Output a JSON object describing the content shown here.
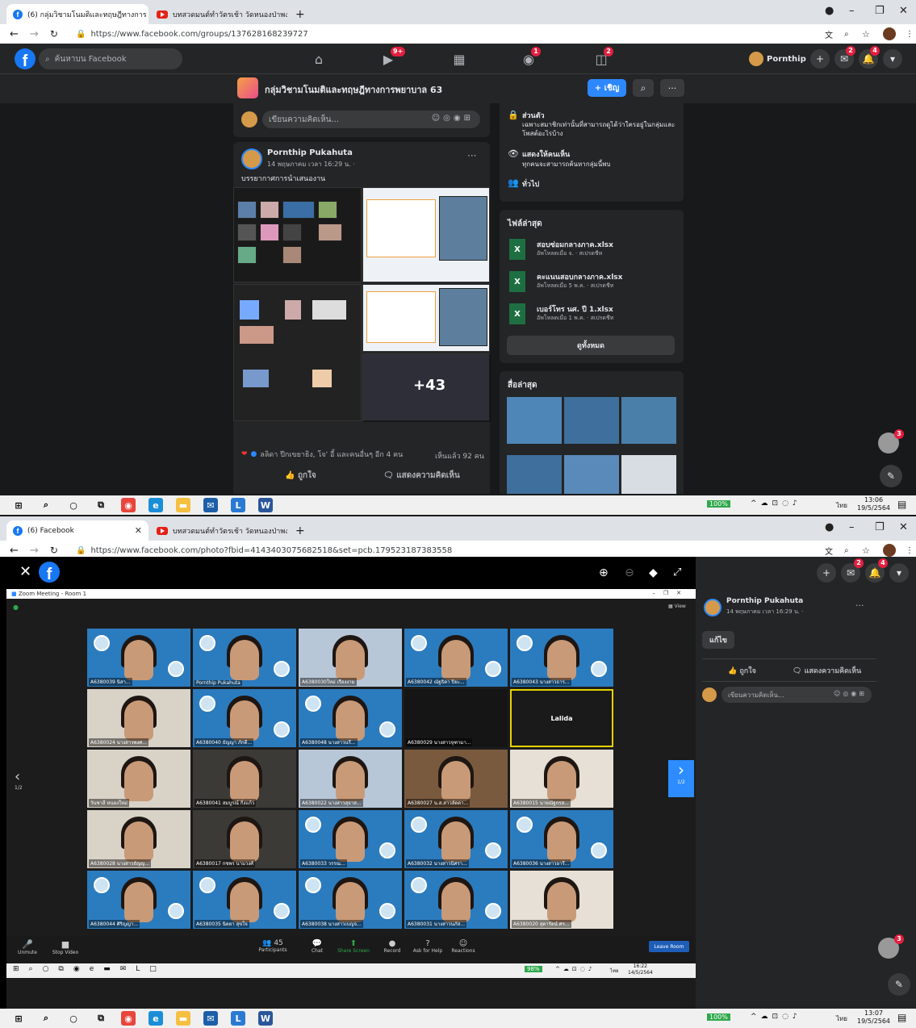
{
  "top": {
    "tabs": [
      {
        "title": "(6) กลุ่มวิชามโนมติและทฤษฎีทางการ"
      },
      {
        "title": "บทสวดมนต์ทำวัตรเช้า วัดหนองป่าพง"
      }
    ],
    "url": "https://www.facebook.com/groups/137628168239727",
    "search_placeholder": "ค้นหาบน Facebook",
    "badges": {
      "watch": "9+",
      "groups": "1",
      "gaming": "2",
      "messenger": "2",
      "notifications": "4"
    },
    "profile_name": "Pornthip",
    "group_name": "กลุ่มวิชามโนมติและทฤษฎีทางการพยาบาล 63",
    "invite_label": "+ เชิญ",
    "comment_placeholder": "เขียนความคิดเห็น...",
    "post": {
      "author": "Pornthip Pukahuta",
      "date": "14 พฤษภาคม เวลา 16:29 น. ·",
      "text": "บรรยากาศการนำเสนองาน",
      "more_count": "+43",
      "reactions_text": "ลลิดา ปีกเขยาธิง, โจ' อี้ และคนอื่นๆ อีก 4 คน",
      "seen_text": "เห็นแล้ว 92 คน",
      "like_label": "ถูกใจ",
      "comment_label": "แสดงความคิดเห็น"
    },
    "about": {
      "private_title": "ส่วนตัว",
      "private_desc": "เฉพาะสมาชิกเท่านั้นที่สามารถดูได้ว่าใครอยู่ในกลุ่มและโพสต์อะไรบ้าง",
      "visible_title": "แสดงให้คนเห็น",
      "visible_desc": "ทุกคนจะสามารถค้นหากลุ่มนี้พบ",
      "general": "ทั่วไป"
    },
    "files": {
      "heading": "ไฟล์ล่าสุด",
      "items": [
        {
          "name": "สอบซ่อมกลางภาค.xlsx",
          "meta": "อัพโหลดเมื่อ จ. · สเปรดชีท"
        },
        {
          "name": "คะแนนสอบกลางภาค.xlsx",
          "meta": "อัพโหลดเมื่อ 5 พ.ค. · สเปรดชีท"
        },
        {
          "name": "เบอร์โทร นศ. ปี 1.xlsx",
          "meta": "อัพโหลดเมื่อ 1 พ.ค. · สเปรดชีท"
        }
      ],
      "see_all": "ดูทั้งหมด"
    },
    "media_heading": "สื่อล่าสุด",
    "chat_badge": "3",
    "taskbar": {
      "battery": "100%",
      "lang": "ไทย",
      "time": "13:06",
      "date": "19/5/2564"
    }
  },
  "bottom": {
    "tabs": [
      {
        "title": "(6) Facebook"
      },
      {
        "title": "บทสวดมนต์ทำวัตรเช้า วัดหนองป่าพง"
      }
    ],
    "url": "https://www.facebook.com/photo?fbid=4143403075682518&set=pcb.179523187383558",
    "zoom_title": "Zoom Meeting - Room 1",
    "view_label": "View",
    "participants": [
      {
        "name": "A6380039 นิสา..."
      },
      {
        "name": "Pornthip Pukahuta"
      },
      {
        "name": "A6380030ใหม่ เรืองงาม"
      },
      {
        "name": "A6380042 ณัฐธิดา ปิยะ..."
      },
      {
        "name": "A6380043 นางสาวธาร..."
      },
      {
        "name": "A6380024 นางสาวพงศ..."
      },
      {
        "name": "A6380040 ธัญญา ภักดี..."
      },
      {
        "name": "A6380048 นางสาวนรี..."
      },
      {
        "name": "A6380029 นางสาวจุฑามา..."
      },
      {
        "name": "Lalida"
      },
      {
        "name": "วันชาลี หนองใหม่"
      },
      {
        "name": "A6380041 สมบูรณ์ กิ่งแก้ว"
      },
      {
        "name": "A6380022 นางสาวสุธาส..."
      },
      {
        "name": "A6380027 น.ส.สาวลัดดา..."
      },
      {
        "name": "A6380015 นายณัฐกรส..."
      },
      {
        "name": "A6380028 นางสาวธัญญ..."
      },
      {
        "name": "A6380017 กชพร นามวงศ์"
      },
      {
        "name": "A6380033 วรรณ..."
      },
      {
        "name": "A6380032 นางสาวนิศรา..."
      },
      {
        "name": "A6380036 นางสาวอารี..."
      },
      {
        "name": "A6380044 ศิริญญา..."
      },
      {
        "name": "A6380035 นิตยา สุขใจ"
      },
      {
        "name": "A6380038 นางสาวเบญจ..."
      },
      {
        "name": "A6380031 นางสาวนภัส..."
      },
      {
        "name": "A6380020 สุดารัตน์ ศร..."
      }
    ],
    "zoom_toolbar": {
      "unmute": "Unmute",
      "stop_video": "Stop Video",
      "participants": "Participants",
      "participants_count": "45",
      "chat": "Chat",
      "share": "Share Screen",
      "record": "Record",
      "help": "Ask for Help",
      "reactions": "Reactions",
      "leave": "Leave Room"
    },
    "page_left": "1/2",
    "page_right": "1/2",
    "inner_taskbar": {
      "battery": "98%",
      "lang": "ไทย",
      "time": "16:22",
      "date": "14/5/2564"
    },
    "side": {
      "author": "Pornthip Pukahuta",
      "date": "14 พฤษภาคม เวลา 16:29 น. ·",
      "edit": "แก้ไข",
      "like": "ถูกใจ",
      "comment": "แสดงความคิดเห็น",
      "comment_placeholder": "เขียนความคิดเห็น..."
    },
    "badges": {
      "messenger": "2",
      "notifications": "4",
      "chat": "3"
    },
    "taskbar": {
      "battery": "100%",
      "lang": "ไทย",
      "time": "13:07",
      "date": "19/5/2564"
    }
  }
}
